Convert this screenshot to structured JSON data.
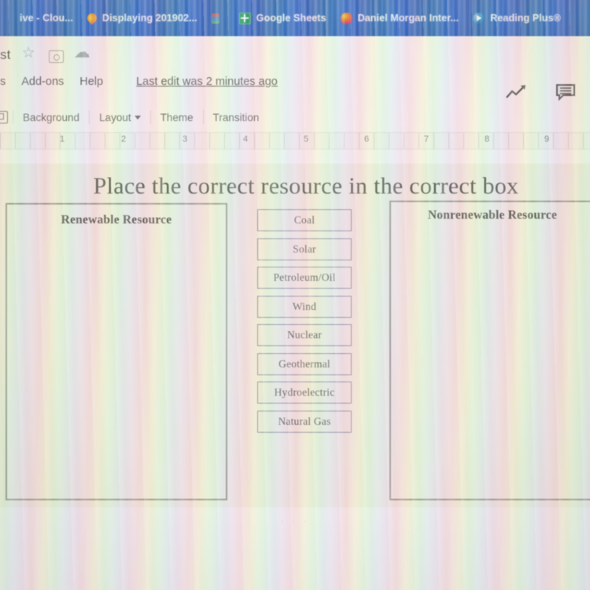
{
  "browser": {
    "tabs": [
      {
        "title": "ive - Clou...",
        "icon": "drive-icon"
      },
      {
        "title": "Displaying 201902...",
        "icon": "location-pin-icon"
      },
      {
        "title": "",
        "icon": "generic-site-icon"
      },
      {
        "title": "Google Sheets",
        "icon": "google-sheets-icon"
      },
      {
        "title": "Daniel Morgan Inter...",
        "icon": "firefox-icon"
      },
      {
        "title": "Reading Plus®",
        "icon": "reading-plus-icon"
      }
    ],
    "tabstrip_color": "#3b6ec6"
  },
  "app": {
    "doc_title": "st",
    "title_icons": [
      "star-icon",
      "move-to-folder-icon",
      "cloud-saved-icon"
    ],
    "menu": [
      "s",
      "Add-ons",
      "Help"
    ],
    "last_edit": "Last edit was 2 minutes ago",
    "right_icons": [
      "explore-trend-icon",
      "comment-icon"
    ],
    "toolbar": {
      "layout_icon": "slide-layout-icon",
      "buttons": [
        {
          "label": "Background",
          "has_caret": false
        },
        {
          "label": "Layout",
          "has_caret": true
        },
        {
          "label": "Theme",
          "has_caret": false
        },
        {
          "label": "Transition",
          "has_caret": false
        }
      ]
    },
    "ruler": {
      "numbers": [
        "1",
        "2",
        "3",
        "4",
        "5",
        "6",
        "7",
        "8",
        "9"
      ]
    }
  },
  "slide": {
    "title": "Place the correct resource in the correct box",
    "background_color": "#eeede0",
    "zones": [
      {
        "label": "Renewable Resource",
        "side": "left"
      },
      {
        "label": "Nonrenewable Resource",
        "side": "right"
      }
    ],
    "resources": [
      "Coal",
      "Solar",
      "Petroleum/Oil",
      "Wind",
      "Nuclear",
      "Geothermal",
      "Hydroelectric",
      "Natural Gas"
    ],
    "pagination_dots": "· · ·"
  }
}
